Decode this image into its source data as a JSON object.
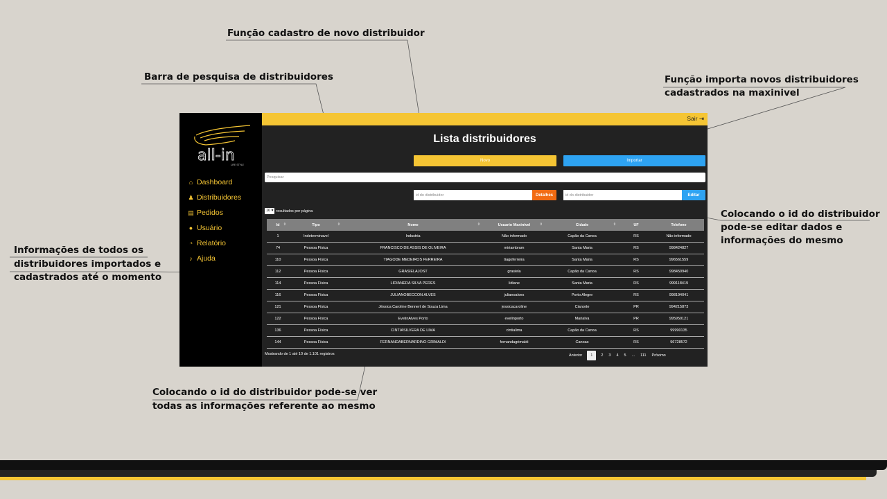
{
  "annotations": {
    "novo": "Função cadastro de novo distribuidor",
    "pesquisa": "Barra de pesquisa de distribuidores",
    "importa_1": "Função importa novos distribuidores",
    "importa_2": "cadastrados na maxinivel",
    "editar_1": "Colocando o id do distribuidor",
    "editar_2": "pode-se editar dados e",
    "editar_3": "informações do mesmo",
    "info_1": "Informações de todos os",
    "info_2": "distribuidores importados e",
    "info_3": "cadastrados até o momento",
    "ver_1": "Colocando o id do distribuidor pode-se ver",
    "ver_2": "todas as informações referente ao mesmo"
  },
  "brand": {
    "name": "all-in",
    "tagline": "LIFE STYLE"
  },
  "sidebar": {
    "items": [
      {
        "icon": "home-icon",
        "label": "Dashboard"
      },
      {
        "icon": "users-icon",
        "label": "Distribuidores"
      },
      {
        "icon": "file-icon",
        "label": "Pedidos"
      },
      {
        "icon": "user-icon",
        "label": "Usuário"
      },
      {
        "icon": "pie-chart-icon",
        "label": "Relatório"
      },
      {
        "icon": "bell-icon",
        "label": "Ajuda"
      }
    ]
  },
  "topbar": {
    "logout": "Sair"
  },
  "page": {
    "title": "Lista distribuidores",
    "novo_label": "Novo",
    "importar_label": "Importar",
    "search_placeholder": "Pesquisar",
    "id_placeholder": "id do distribuidor",
    "detalhes_label": "Detalhes",
    "editar_label": "Editar",
    "per_page_value": "10",
    "per_page_label": "resultados por página"
  },
  "table": {
    "headers": [
      "Id",
      "Tipo",
      "Nome",
      "Usuario Maxinivel",
      "Cidade",
      "UF",
      "Telefone"
    ],
    "rows": [
      [
        "1",
        "Indeterminavel",
        "Industria",
        "Não informado",
        "Capão da Canoa",
        "RS",
        "Não informado"
      ],
      [
        "74",
        "Pessoa Física",
        "FRANCISCO DE ASSIS DE OLIVEIRA",
        "miriambrum",
        "Santa Maria",
        "RS",
        "998424827"
      ],
      [
        "110",
        "Pessoa Física",
        "TIAGODE MEDEIROS FERREIRA",
        "tiagoferreira",
        "Santa Maria",
        "RS",
        "996561559"
      ],
      [
        "112",
        "Pessoa Física",
        "GRASIELAJOST",
        "grasiela",
        "Capão da Canoa",
        "RS",
        "998450940"
      ],
      [
        "114",
        "Pessoa Física",
        "LIDIANEDA SILVA PERES",
        "lidiane",
        "Santa Maria",
        "RS",
        "999118419"
      ],
      [
        "116",
        "Pessoa Física",
        "JULIANOBECCON ALVES",
        "julianoalves",
        "Porto Alegre",
        "RS",
        "998194041"
      ],
      [
        "121",
        "Pessoa Física",
        "Jéssica Caroline Bennert de Souza Lima",
        "jessicacaroline",
        "Cianorte",
        "PR",
        "994215873"
      ],
      [
        "122",
        "Pessoa Física",
        "EvelinAlves Porto",
        "evelinporto",
        "Marialva",
        "PR",
        "995950121"
      ],
      [
        "136",
        "Pessoa Física",
        "CINTIASILVERA DE LIMA",
        "cintialima",
        "Capão da Canoa",
        "RS",
        "99990135"
      ],
      [
        "144",
        "Pessoa Física",
        "FERNANDABERNARDINO GRIMALDI",
        "fernandagrimaldi",
        "Canoas",
        "RS",
        "96728572"
      ]
    ]
  },
  "footer": {
    "info": "Mostrando de 1 até 10 de 1.101 registros",
    "prev": "Anterior",
    "pages": [
      "1",
      "2",
      "3",
      "4",
      "5",
      "...",
      "111"
    ],
    "next": "Próximo"
  },
  "colors": {
    "accent": "#f5c534",
    "blue": "#2ea3f2",
    "orange": "#f26b12"
  }
}
